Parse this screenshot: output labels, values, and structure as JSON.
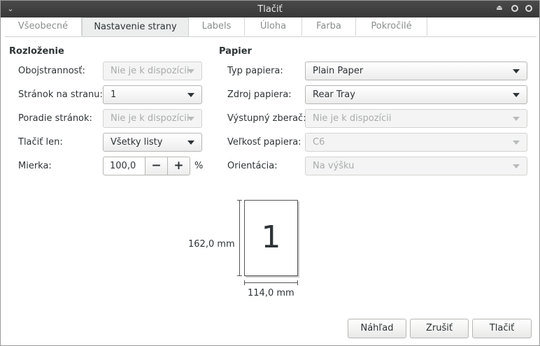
{
  "window": {
    "title": "Tlačiť"
  },
  "tabs": [
    {
      "label": "Všeobecné"
    },
    {
      "label": "Nastavenie strany"
    },
    {
      "label": "Labels"
    },
    {
      "label": "Úloha"
    },
    {
      "label": "Farba"
    },
    {
      "label": "Pokročilé"
    }
  ],
  "layout": {
    "title": "Rozloženie",
    "duplex": {
      "label": "Obojstrannosť:",
      "value": "Nie je k dispozícii"
    },
    "pages_per_side": {
      "label": "Stránok na stranu:",
      "value": "1"
    },
    "page_order": {
      "label": "Poradie stránok:",
      "value": "Nie je k dispozícii"
    },
    "print_only": {
      "label": "Tlačiť len:",
      "value": "Všetky listy"
    },
    "scale": {
      "label": "Mierka:",
      "value": "100,0",
      "minus": "−",
      "plus": "+",
      "unit": "%"
    }
  },
  "paper": {
    "title": "Papier",
    "type": {
      "label": "Typ papiera:",
      "value": "Plain Paper"
    },
    "source": {
      "label": "Zdroj papiera:",
      "value": "Rear Tray"
    },
    "output_tray": {
      "label": "Výstupný zberač:",
      "value": "Nie je k dispozícii"
    },
    "size": {
      "label": "Veľkosť papiera:",
      "value": "C6"
    },
    "orientation": {
      "label": "Orientácia:",
      "value": "Na výšku"
    }
  },
  "preview": {
    "page_number": "1",
    "height": "162,0 mm",
    "width": "114,0 mm"
  },
  "buttons": {
    "preview": "Náhľad",
    "cancel": "Zrušiť",
    "print": "Tlačiť"
  }
}
